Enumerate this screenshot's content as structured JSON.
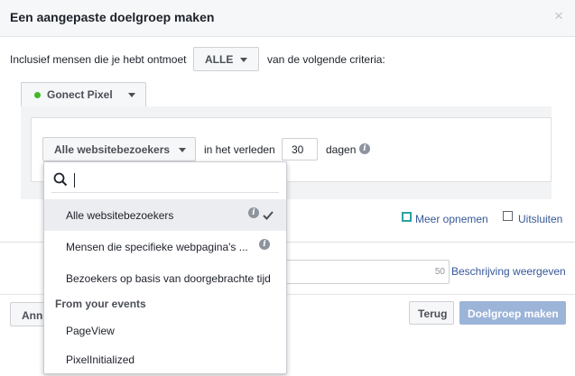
{
  "dialog": {
    "title": "Een aangepaste doelgroep maken",
    "close_icon": "close-icon"
  },
  "criteria": {
    "prefix": "Inclusief mensen die je hebt ontmoet",
    "selector_value": "ALLE",
    "suffix": "van de volgende criteria:"
  },
  "pixel": {
    "label": "Gonect Pixel",
    "status_color": "#42b72a"
  },
  "rule": {
    "visitors_value": "Alle websitebezoekers",
    "in_past_label": "in het verleden",
    "days_value": "30",
    "days_label": "dagen"
  },
  "dropdown": {
    "search_value": "",
    "items": [
      {
        "label": "Alle websitebezoekers",
        "info": true,
        "checked": true
      },
      {
        "label": "Mensen die specifieke webpagina's ...",
        "info": true,
        "checked": false
      },
      {
        "label": "Bezoekers op basis van doorgebrachte tijd",
        "info": false,
        "checked": false
      }
    ],
    "section_header": "From your events",
    "events": [
      {
        "label": "PageView"
      },
      {
        "label": "PixelInitialized"
      }
    ]
  },
  "actions": {
    "include_more": "Meer opnemen",
    "exclude": "Uitsluiten"
  },
  "name_field": {
    "char_count": "50",
    "show_description": "Beschrijving weergeven"
  },
  "footer": {
    "cancel_partial": "Ann",
    "back": "Terug",
    "create": "Doelgroep maken"
  },
  "colors": {
    "link": "#365899",
    "primary_disabled": "#9cb4d8",
    "header_bg": "#f6f7f9"
  }
}
